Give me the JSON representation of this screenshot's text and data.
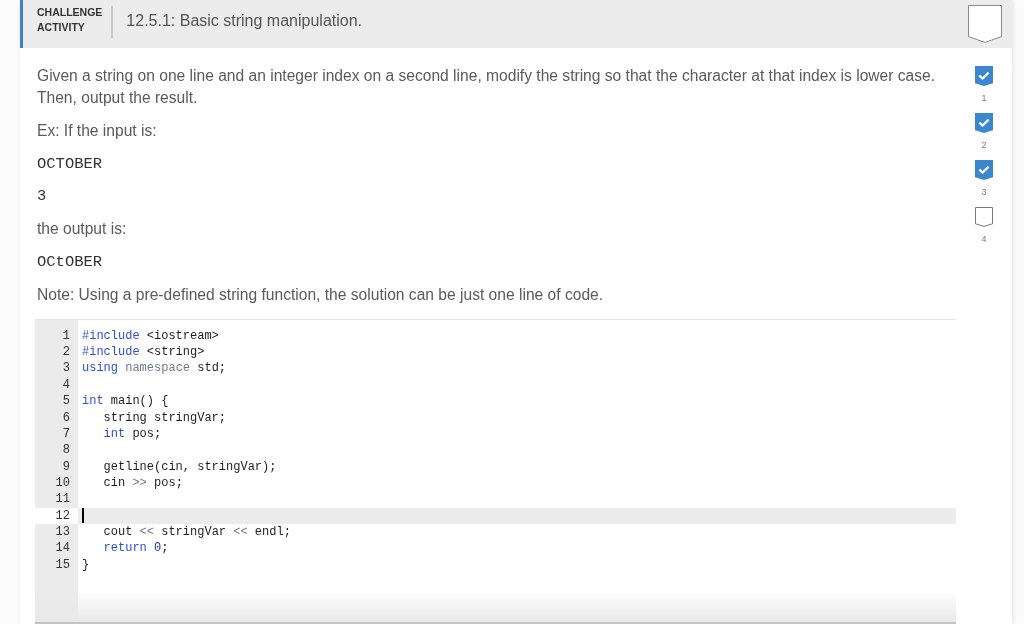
{
  "header": {
    "label": "CHALLENGE ACTIVITY",
    "title": "12.5.1: Basic string manipulation.",
    "completed": false
  },
  "prompt": [
    {
      "kind": "text",
      "text": "Given a string on one line and an integer index on a second line, modify the string so that the character at that index is lower case. Then, output the result."
    },
    {
      "kind": "text",
      "text": "Ex: If the input is:"
    },
    {
      "kind": "sample",
      "text": "OCTOBER"
    },
    {
      "kind": "sample",
      "text": "3"
    },
    {
      "kind": "text",
      "text": "the output is:"
    },
    {
      "kind": "sample",
      "text": "OCtOBER"
    },
    {
      "kind": "text",
      "text": "Note: Using a pre-defined string function, the solution can be just one line of code."
    }
  ],
  "levels": [
    {
      "label": "1",
      "completed": true
    },
    {
      "label": "2",
      "completed": true
    },
    {
      "label": "3",
      "completed": true
    },
    {
      "label": "4",
      "completed": false
    }
  ],
  "editor": {
    "lines": [
      {
        "number": "1",
        "active": false,
        "tokens": [
          {
            "kind": "keyword",
            "text": "#include"
          },
          {
            "kind": "plain",
            "text": " <iostream>"
          }
        ]
      },
      {
        "number": "2",
        "active": false,
        "tokens": [
          {
            "kind": "keyword",
            "text": "#include"
          },
          {
            "kind": "plain",
            "text": " <string>"
          }
        ]
      },
      {
        "number": "3",
        "active": false,
        "tokens": [
          {
            "kind": "keyword",
            "text": "using"
          },
          {
            "kind": "operator",
            "text": " namespace"
          },
          {
            "kind": "plain",
            "text": " std;"
          }
        ]
      },
      {
        "number": "4",
        "active": false
      },
      {
        "number": "5",
        "active": false,
        "tokens": [
          {
            "kind": "keyword",
            "text": "int"
          },
          {
            "kind": "plain",
            "text": " main() {"
          }
        ]
      },
      {
        "number": "6",
        "active": false,
        "tokens": [
          {
            "kind": "plain",
            "text": "   string stringVar;"
          }
        ]
      },
      {
        "number": "7",
        "active": false,
        "tokens": [
          {
            "kind": "keyword",
            "text": "   int"
          },
          {
            "kind": "plain",
            "text": " pos;"
          }
        ]
      },
      {
        "number": "8",
        "active": false
      },
      {
        "number": "9",
        "active": false,
        "tokens": [
          {
            "kind": "plain",
            "text": "   getline(cin, stringVar);"
          }
        ]
      },
      {
        "number": "10",
        "active": false,
        "tokens": [
          {
            "kind": "plain",
            "text": "   cin "
          },
          {
            "kind": "operator",
            "text": ">>"
          },
          {
            "kind": "plain",
            "text": " pos;"
          }
        ]
      },
      {
        "number": "11",
        "active": false
      },
      {
        "number": "12",
        "active": true
      },
      {
        "number": "13",
        "active": false,
        "tokens": [
          {
            "kind": "plain",
            "text": "   cout "
          },
          {
            "kind": "operator",
            "text": "<<"
          },
          {
            "kind": "plain",
            "text": " stringVar "
          },
          {
            "kind": "operator",
            "text": "<<"
          },
          {
            "kind": "plain",
            "text": " endl;"
          }
        ]
      },
      {
        "number": "14",
        "active": false,
        "tokens": [
          {
            "kind": "keyword",
            "text": "   return"
          },
          {
            "kind": "number",
            "text": " 0"
          },
          {
            "kind": "plain",
            "text": ";"
          }
        ]
      },
      {
        "number": "15",
        "active": false,
        "tokens": [
          {
            "kind": "plain",
            "text": "}"
          }
        ]
      }
    ]
  }
}
